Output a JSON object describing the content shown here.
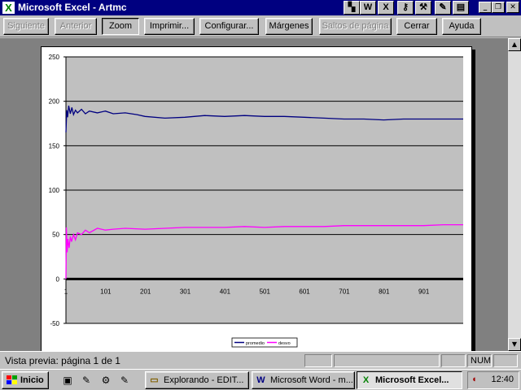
{
  "window": {
    "title": "Microsoft Excel - Artmc",
    "app_icon": "excel-x-icon",
    "tray_icons": [
      "color-icon",
      "word-w-icon",
      "excel-x-icon",
      "key-icon",
      "tool-icon",
      "pencil-icon",
      "pdf-icon"
    ],
    "tray_glyphs": [
      "▚",
      "W",
      "X",
      "⚷",
      "⚒",
      "✎",
      "▤"
    ],
    "controls": [
      "_",
      "❐",
      "✕"
    ]
  },
  "toolbar": {
    "buttons": [
      {
        "label": "Siguiente",
        "enabled": false
      },
      {
        "label": "Anterior",
        "enabled": false
      },
      {
        "label": "Zoom",
        "enabled": true,
        "pressed": true
      },
      {
        "label": "Imprimir...",
        "enabled": true
      },
      {
        "label": "Configurar...",
        "enabled": true
      },
      {
        "label": "Márgenes",
        "enabled": true
      },
      {
        "label": "Saltos de página",
        "enabled": false
      },
      {
        "label": "Cerrar",
        "enabled": true
      },
      {
        "label": "Ayuda",
        "enabled": true
      }
    ]
  },
  "chart_data": {
    "type": "line",
    "title": "",
    "xlabel": "",
    "ylabel": "",
    "xlim": [
      1,
      1000
    ],
    "ylim": [
      -50,
      250
    ],
    "yticks": [
      -50,
      0,
      50,
      100,
      150,
      200,
      250
    ],
    "xticks": [
      1,
      101,
      201,
      301,
      401,
      501,
      601,
      701,
      801,
      901
    ],
    "grid": "horizontal",
    "plot_background": "#c0c0c0",
    "legend_position": "bottom",
    "series": [
      {
        "name": "promedio",
        "color": "#000080",
        "x": [
          1,
          3,
          5,
          8,
          12,
          16,
          20,
          25,
          30,
          40,
          50,
          60,
          80,
          100,
          120,
          150,
          180,
          200,
          250,
          300,
          350,
          400,
          450,
          500,
          550,
          600,
          650,
          700,
          750,
          800,
          850,
          900,
          950,
          1000
        ],
        "y": [
          165,
          190,
          182,
          195,
          186,
          193,
          185,
          190,
          187,
          191,
          186,
          189,
          187,
          189,
          186,
          187,
          185,
          183,
          181,
          182,
          184,
          183,
          184,
          183,
          183,
          182,
          181,
          180,
          180,
          179,
          180,
          180,
          180,
          180
        ]
      },
      {
        "name": "desvo",
        "color": "#ff00ff",
        "x": [
          1,
          2,
          4,
          6,
          9,
          12,
          15,
          20,
          25,
          30,
          40,
          50,
          60,
          80,
          100,
          120,
          150,
          200,
          250,
          300,
          350,
          400,
          450,
          500,
          550,
          600,
          650,
          700,
          750,
          800,
          850,
          900,
          950,
          1000
        ],
        "y": [
          0,
          58,
          30,
          45,
          35,
          48,
          42,
          50,
          44,
          52,
          50,
          55,
          52,
          57,
          55,
          56,
          57,
          56,
          57,
          58,
          58,
          58,
          59,
          58,
          59,
          59,
          59,
          60,
          60,
          60,
          60,
          60,
          61,
          61
        ]
      }
    ]
  },
  "status": {
    "text": "Vista previa: página 1 de 1",
    "num": "NUM"
  },
  "taskbar": {
    "start_label": "Inicio",
    "quick_launch": [
      "desktop-icon",
      "outlook-icon",
      "tool-icon",
      "wrench-icon"
    ],
    "quick_glyphs": [
      "▣",
      "✎",
      "⚙",
      "✎"
    ],
    "tasks": [
      {
        "label": "Explorando - EDIT...",
        "icon": "folder-icon",
        "glyph": "▭",
        "active": false
      },
      {
        "label": "Microsoft Word - m...",
        "icon": "word-w-icon",
        "glyph": "W",
        "active": false
      },
      {
        "label": "Microsoft Excel...",
        "icon": "excel-x-icon",
        "glyph": "X",
        "active": true
      }
    ],
    "clock": "12:40"
  }
}
